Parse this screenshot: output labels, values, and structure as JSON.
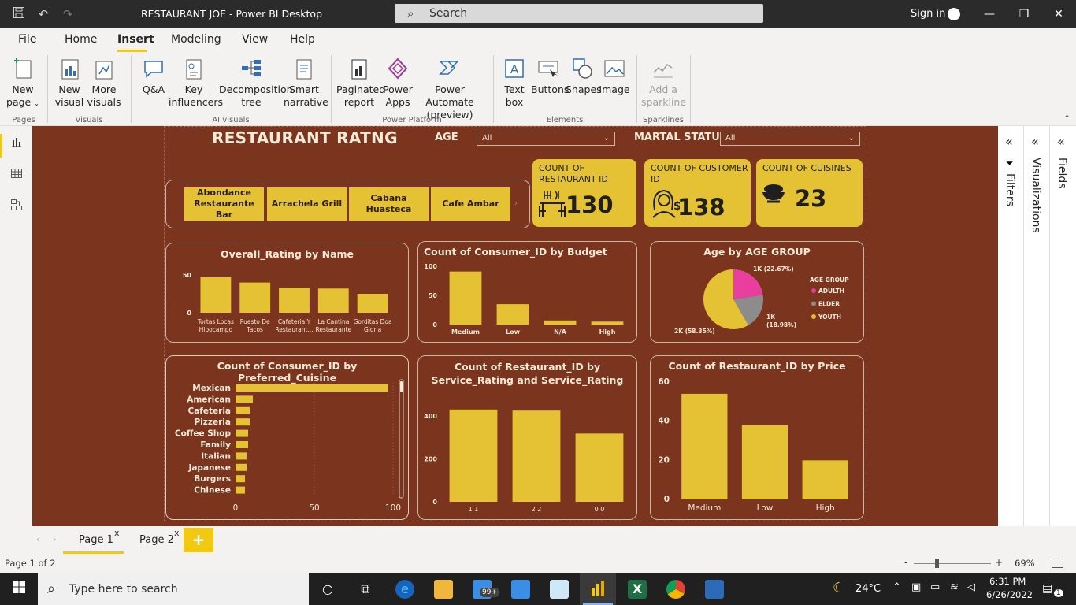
{
  "window": {
    "title": "RESTAURANT JOE - Power BI Desktop",
    "search_placeholder": "Search",
    "signin": "Sign in"
  },
  "menu": {
    "file": "File",
    "home": "Home",
    "insert": "Insert",
    "modeling": "Modeling",
    "view": "View",
    "help": "Help"
  },
  "ribbon": {
    "new_page": "New page",
    "new_visual": "New visual",
    "more_visuals": "More visuals",
    "qa": "Q&A",
    "key_influencers": "Key influencers",
    "decomposition_tree": "Decomposition tree",
    "smart_narrative": "Smart narrative",
    "paginated_report": "Paginated report",
    "power_apps": "Power Apps",
    "power_automate": "Power Automate (preview)",
    "text_box": "Text box",
    "buttons": "Buttons",
    "shapes": "Shapes",
    "image": "Image",
    "add_sparkline": "Add a sparkline",
    "groups": {
      "pages": "Pages",
      "visuals": "Visuals",
      "ai_visuals": "AI visuals",
      "power_platform": "Power Platform",
      "elements": "Elements",
      "sparklines": "Sparklines"
    }
  },
  "report": {
    "title": "RESTAURANT RATNG",
    "age_label": "AGE",
    "age_value": "All",
    "marital_label": "MARTAL STATUS",
    "marital_value": "All",
    "slicer_chips": [
      "Abondance Restaurante Bar",
      "Arrachela Grill",
      "Cabana Huasteca",
      "Cafe Ambar"
    ],
    "cards": [
      {
        "title": "COUNT OF RESTAURANT ID",
        "value": "130"
      },
      {
        "title": "COUNT OF CUSTOMER ID",
        "value": "138"
      },
      {
        "title": "COUNT OF CUISINES",
        "value": "23"
      }
    ]
  },
  "chart_data": [
    {
      "type": "bar",
      "title": "Overall_Rating by Name",
      "categories": [
        "Tortas Locas Hipocampo",
        "Puesto De Tacos",
        "Cafeteria Y Restaurant...",
        "La Cantina Restaurante",
        "Gorditas Doa Gloria"
      ],
      "values": [
        47,
        40,
        33,
        32,
        25
      ],
      "ylim": [
        0,
        50
      ],
      "yticks": [
        "50",
        "0"
      ]
    },
    {
      "type": "bar",
      "title": "Count of Consumer_ID by Budget",
      "categories": [
        "Medium",
        "Low",
        "N/A",
        "High"
      ],
      "values": [
        91,
        35,
        7,
        5
      ],
      "ylim": [
        0,
        100
      ],
      "yticks": [
        "100",
        "50",
        "0"
      ]
    },
    {
      "type": "pie",
      "title": "Age by AGE GROUP",
      "legend_title": "AGE GROUP",
      "slices": [
        {
          "label": "ADULTH",
          "percent": 22.67,
          "data_label": "1K (22.67%)",
          "color": "#e83e9d"
        },
        {
          "label": "ELDER",
          "percent": 18.98,
          "data_label": "1K (18.98%)",
          "color": "#8c8c8c"
        },
        {
          "label": "YOUTH",
          "percent": 58.35,
          "data_label": "2K (58.35%)",
          "color": "#e5c233"
        }
      ]
    },
    {
      "type": "bar",
      "orientation": "horizontal",
      "title": "Count of Consumer_ID by Preferred_Cuisine",
      "categories": [
        "Mexican",
        "American",
        "Cafeteria",
        "Pizzeria",
        "Coffee Shop",
        "Family",
        "Italian",
        "Japanese",
        "Burgers",
        "Chinese"
      ],
      "values": [
        97,
        11,
        9,
        9,
        8,
        8,
        7,
        7,
        6,
        6
      ],
      "xlim": [
        0,
        100
      ],
      "xticks": [
        "0",
        "50",
        "100"
      ]
    },
    {
      "type": "bar",
      "title": "Count of Restaurant_ID by Service_Rating and Service_Rating",
      "categories": [
        "1 1",
        "2 2",
        "0 0"
      ],
      "values": [
        430,
        425,
        318
      ],
      "ylim": [
        0,
        400
      ],
      "yticks": [
        "400",
        "200",
        "0"
      ]
    },
    {
      "type": "bar",
      "title": "Count of Restaurant_ID by Price",
      "categories": [
        "Medium",
        "Low",
        "High"
      ],
      "values": [
        54,
        38,
        20
      ],
      "ylim": [
        0,
        60
      ],
      "yticks": [
        "60",
        "40",
        "20",
        "0"
      ]
    }
  ],
  "panes": {
    "filters": "Filters",
    "visualizations": "Visualizations",
    "fields": "Fields"
  },
  "pages": {
    "tab1": "Page 1",
    "tab2": "Page 2",
    "close": "x",
    "add": "+"
  },
  "status": {
    "page_info": "Page 1 of 2",
    "zoom": "69%",
    "minus": "-",
    "plus": "+"
  },
  "taskbar": {
    "search": "Type here to search",
    "weather": "24°C",
    "time": "6:31 PM",
    "date": "6/26/2022",
    "mail_badge": "99+",
    "notif_count": "1"
  },
  "colors": {
    "canvas": "#7b341e",
    "accent": "#e5c233",
    "title_text": "#f4ead5",
    "pbi_yellow": "#f2c811"
  }
}
